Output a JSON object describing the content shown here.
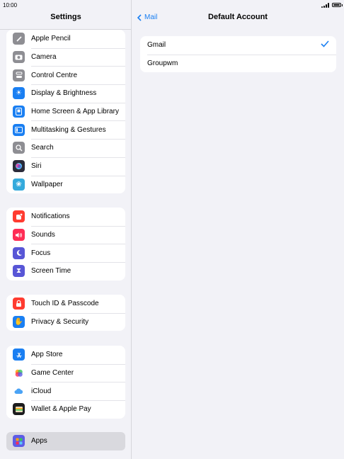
{
  "status": {
    "time": "10:00"
  },
  "sidebar": {
    "title": "Settings",
    "groups": [
      {
        "items": [
          {
            "label": "Apple Pencil",
            "icon": "pencil-icon",
            "color": "#8e8e93"
          },
          {
            "label": "Camera",
            "icon": "camera-icon",
            "color": "#8e8e93"
          },
          {
            "label": "Control Centre",
            "icon": "toggles-icon",
            "color": "#8e8e93"
          },
          {
            "label": "Display & Brightness",
            "icon": "sun-icon",
            "color": "#1a7ff2"
          },
          {
            "label": "Home Screen & App Library",
            "icon": "home-screen-icon",
            "color": "#1a7ff2"
          },
          {
            "label": "Multitasking & Gestures",
            "icon": "multitasking-icon",
            "color": "#1a7ff2"
          },
          {
            "label": "Search",
            "icon": "search-icon",
            "color": "#8e8e93"
          },
          {
            "label": "Siri",
            "icon": "siri-icon",
            "color": "#2b2b3a"
          },
          {
            "label": "Wallpaper",
            "icon": "flower-icon",
            "color": "#34aadc"
          }
        ]
      },
      {
        "items": [
          {
            "label": "Notifications",
            "icon": "bell-icon",
            "color": "#ff3b30"
          },
          {
            "label": "Sounds",
            "icon": "speaker-icon",
            "color": "#ff2d55"
          },
          {
            "label": "Focus",
            "icon": "moon-icon",
            "color": "#5856d6"
          },
          {
            "label": "Screen Time",
            "icon": "hourglass-icon",
            "color": "#5856d6"
          }
        ]
      },
      {
        "items": [
          {
            "label": "Touch ID & Passcode",
            "icon": "lock-icon",
            "color": "#ff3b30"
          },
          {
            "label": "Privacy & Security",
            "icon": "hand-icon",
            "color": "#1a7ff2"
          }
        ]
      },
      {
        "items": [
          {
            "label": "App Store",
            "icon": "app-store-icon",
            "color": "#1a7ff2"
          },
          {
            "label": "Game Center",
            "icon": "game-center-icon",
            "color": "#ffffff"
          },
          {
            "label": "iCloud",
            "icon": "cloud-icon",
            "color": "#ffffff"
          },
          {
            "label": "Wallet & Apple Pay",
            "icon": "wallet-icon",
            "color": "#1c1c1e"
          }
        ]
      },
      {
        "items": [
          {
            "label": "Apps",
            "icon": "apps-grid-icon",
            "color": "#5e5ce6",
            "selected": true
          }
        ]
      }
    ]
  },
  "detail": {
    "back_label": "Mail",
    "title": "Default Account",
    "accounts": [
      {
        "label": "Gmail",
        "checked": true
      },
      {
        "label": "Groupwm",
        "checked": false
      }
    ]
  },
  "colors": {
    "accent": "#1a7ff2"
  }
}
